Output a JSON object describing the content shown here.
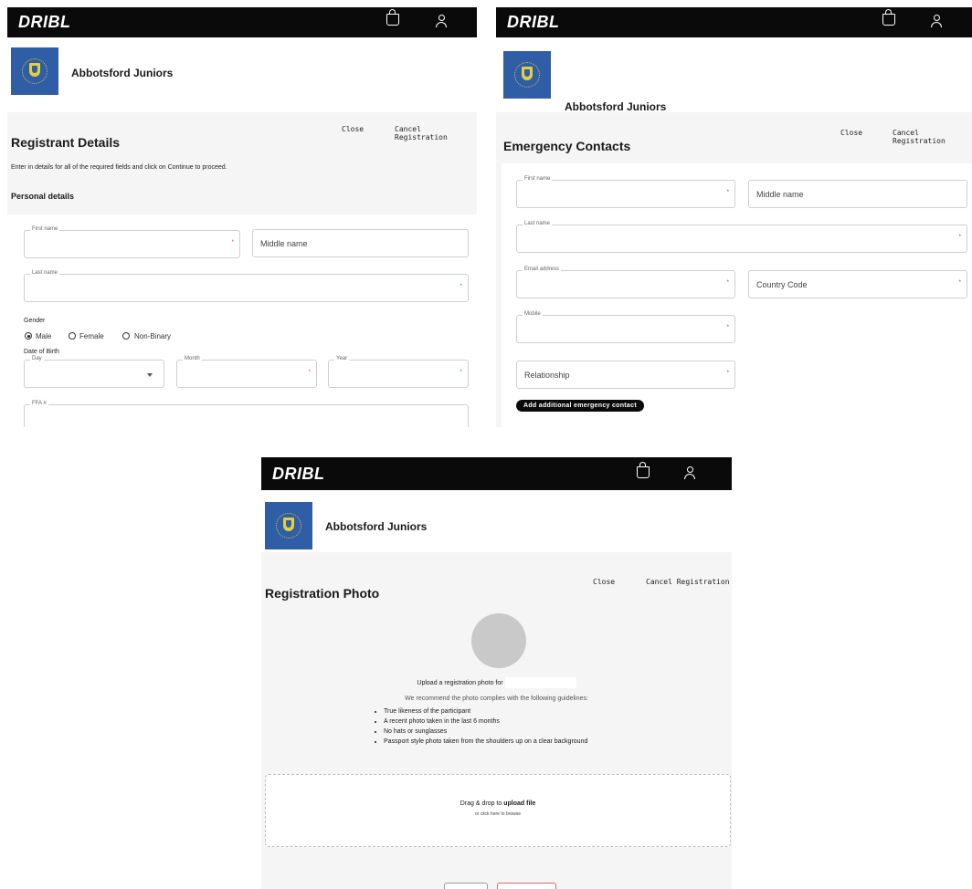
{
  "brand": "DRIBL",
  "club": {
    "name": "Abbotsford Juniors"
  },
  "actions": {
    "close": "Close",
    "cancel": "Cancel Registration"
  },
  "registrant": {
    "title": "Registrant Details",
    "instructions": "Enter in details for all of the required fields and click on Continue to proceed.",
    "section": "Personal details",
    "first_name_label": "First name",
    "middle_name_placeholder": "Middle name",
    "last_name_label": "Last name",
    "gender_label": "Gender",
    "gender_options": [
      "Male",
      "Female",
      "Non-Binary"
    ],
    "gender_selected": "Male",
    "dob_label": "Date of Birth",
    "day_label": "Day",
    "month_label": "Month",
    "year_label": "Year",
    "ffa_label": "FFA #"
  },
  "emergency": {
    "title": "Emergency Contacts",
    "first_name_label": "First name",
    "middle_name_placeholder": "Middle name",
    "last_name_label": "Last name",
    "email_label": "Email address",
    "country_code_placeholder": "Country Code",
    "mobile_label": "Mobile",
    "relationship_placeholder": "Relationship",
    "add_button": "Add additional emergency contact"
  },
  "photo": {
    "title": "Registration Photo",
    "upload_prompt": "Upload a registration photo for",
    "recommend": "We recommend the photo complies with the following guidelines:",
    "guidelines": [
      "True likeness of the participant",
      "A recent photo taken in the last 6 months",
      "No hats or sunglasses",
      "Passport style photo taken from the shoulders up on a clear background"
    ],
    "drop_prefix": "Drag & drop to",
    "drop_strong": "upload file",
    "browse": "or click here to browse"
  },
  "icons": [
    "bag-icon",
    "user-icon",
    "club-logo-icon"
  ],
  "colors": {
    "topbar": "#0a0a0a",
    "logo_bg": "#2f5ea6",
    "logo_gold": "#e4cf3c",
    "panel_grey": "#f5f5f5"
  }
}
